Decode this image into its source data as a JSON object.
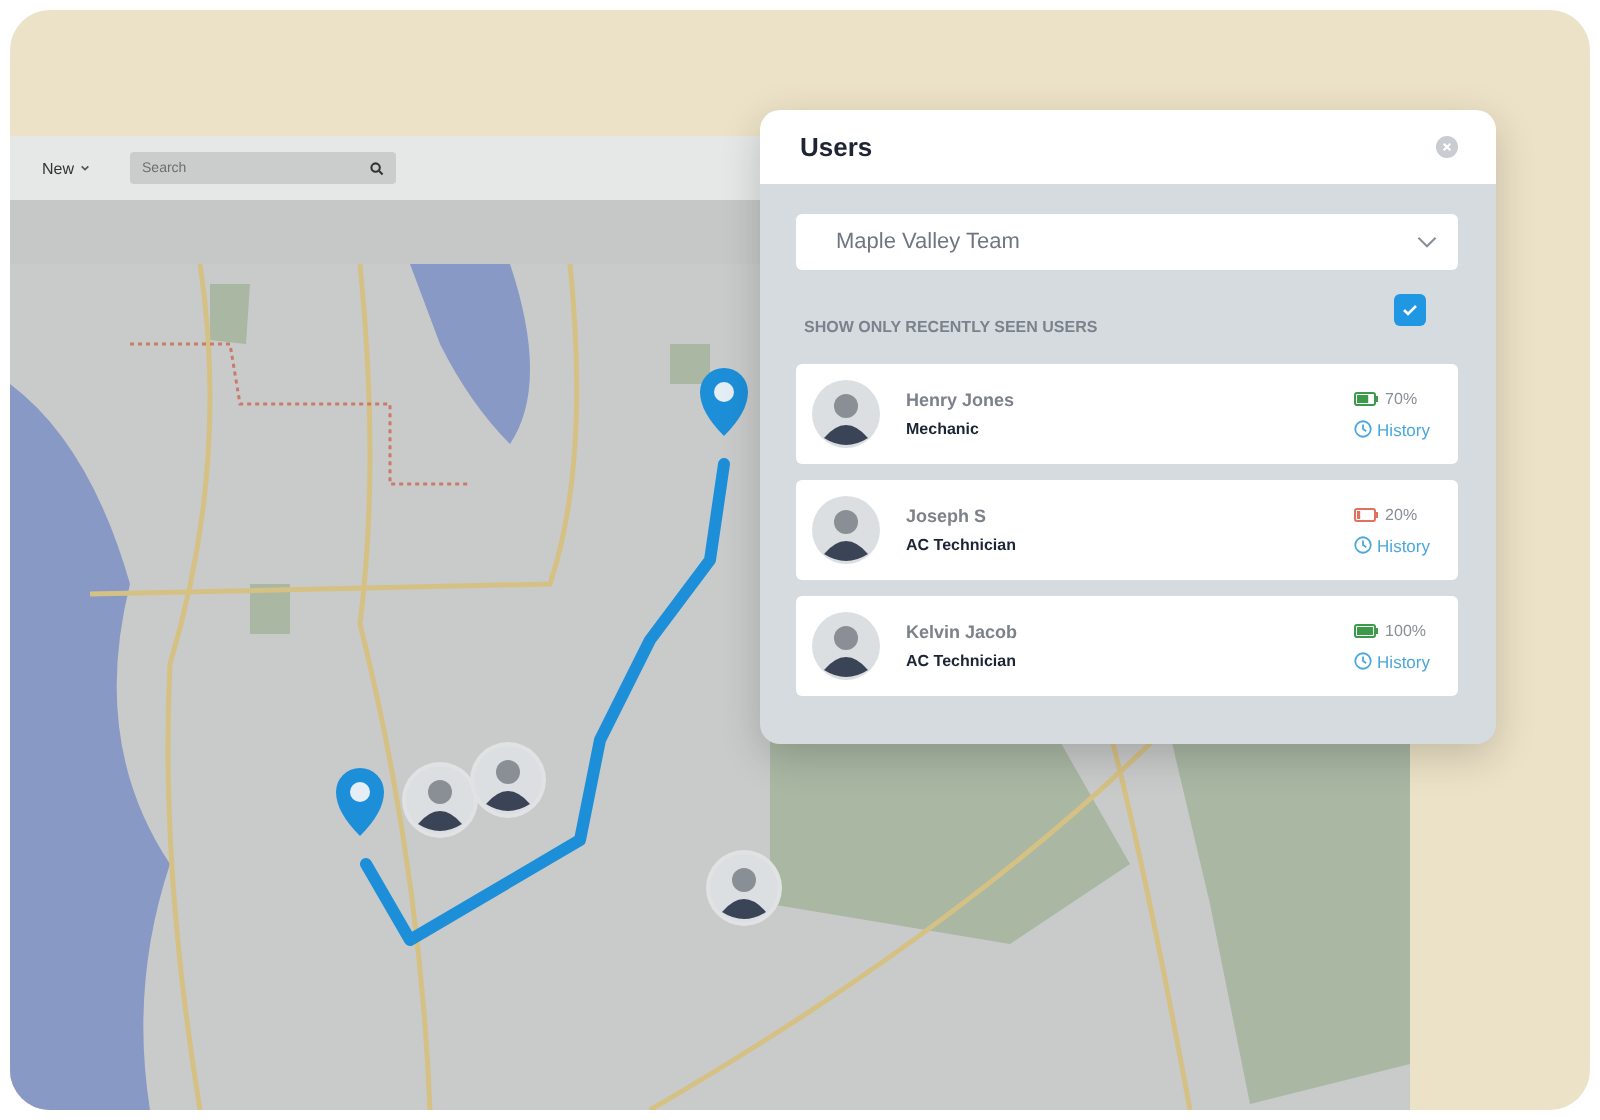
{
  "toolbar": {
    "new_button": "New",
    "search": {
      "placeholder": "Search"
    }
  },
  "users_panel": {
    "title": "Users",
    "team_select": {
      "value": "Maple Valley Team"
    },
    "recent_filter": {
      "label": "SHOW ONLY RECENTLY SEEN USERS",
      "checked": true
    },
    "users": [
      {
        "name": "Henry Jones",
        "role": "Mechanic",
        "battery": "70%",
        "level": 0.7,
        "history": "History"
      },
      {
        "name": "Joseph S",
        "role": "AC Technician",
        "battery": "20%",
        "level": 0.2,
        "history": "History"
      },
      {
        "name": "Kelvin Jacob",
        "role": "AC Technician",
        "battery": "100%",
        "level": 1,
        "history": "History"
      }
    ]
  }
}
